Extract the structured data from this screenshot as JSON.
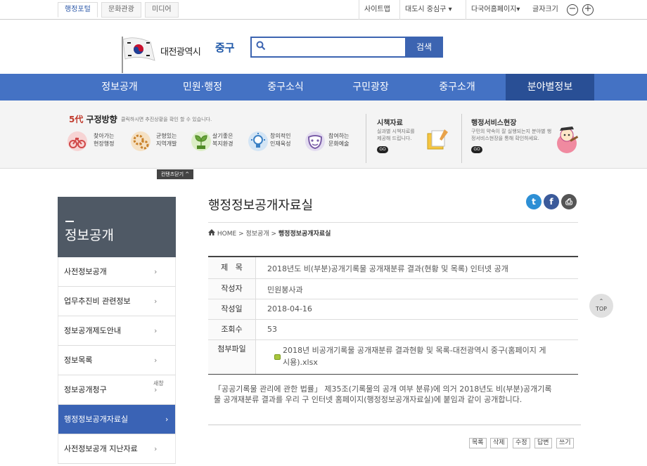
{
  "util": {
    "portal_tabs": [
      "행정포털",
      "문화관광",
      "미디어"
    ],
    "sitemap": "사이트맵",
    "district": "대도시 중심구",
    "multilang": "다국어홈페이지",
    "fontsize": "글자크기",
    "minus": "−",
    "plus": "+"
  },
  "header": {
    "city": "대전광역시",
    "gu": "중구",
    "search_icon_glyph": "🔍",
    "search_btn": "검색"
  },
  "gnb": [
    "정보공개",
    "민원·행정",
    "중구소식",
    "구민광장",
    "중구소개",
    "분야별정보"
  ],
  "banner": {
    "five_num": "5代",
    "five_title": "구정방향",
    "five_desc": "클릭하시면 추진상황을 확인 할 수 있습니다.",
    "items": [
      {
        "l1": "찾아가는",
        "l2": "현장행정"
      },
      {
        "l1": "균형있는",
        "l2": "지역개발"
      },
      {
        "l1": "살기좋은",
        "l2": "복지환경"
      },
      {
        "l1": "창의적인",
        "l2": "인재육성"
      },
      {
        "l1": "참여하는",
        "l2": "문화예술"
      }
    ],
    "policy_title": "시책자료",
    "policy_desc": "실과별 시책자료를 제공해 드립니다.",
    "service_title": "행정서비스현장",
    "service_desc": "구민의 약속이 잘 실행되는지 분야별 행정서비스현장을 통해 확인하세요.",
    "go": "GO",
    "close_tab": "컨텐츠닫기 ^"
  },
  "sidebar": {
    "title": "정보공개",
    "items": [
      "사전정보공개",
      "업무추진비 관련정보",
      "정보공개제도안내",
      "정보목록",
      "정보공개청구",
      "행정정보공개자료실",
      "사전정보공개 지난자료"
    ],
    "new_window": "새창"
  },
  "main": {
    "title": "행정정보공개자료실",
    "social": {
      "twitter": "t",
      "facebook": "f",
      "print": "⎙"
    },
    "breadcrumb": {
      "home": "HOME",
      "sep": ">",
      "level1": "정보공개",
      "current": "행정정보공개자료실"
    },
    "fields": {
      "title_label": "제   목",
      "title_value": "2018년도 비(부분)공개기록물 공개재분류 결과(현황 및 목록) 인터넷 공개",
      "author_label": "작성자",
      "author_value": "민원봉사과",
      "date_label": "작성일",
      "date_value": "2018-04-16",
      "views_label": "조회수",
      "views_value": "53",
      "file_label": "첨부파일",
      "file_line1": "2018년 비공개기록물 공개재분류 결과현황 및 목록-대전광역시 중구(홈페이지 게",
      "file_line2": "시용).xlsx"
    },
    "content_line1": "「공공기록물 관리에 관한 법률」 제35조(기록물의 공개 여부 분류)에 의거 2018년도 비(부분)공개기록",
    "content_line2": "물 공개재분류 결과를 우리 구 인터넷 홈페이지(행정정보공개자료실)에 붙임과 같이 공개합니다.",
    "buttons": [
      "목록",
      "삭제",
      "수정",
      "답변",
      "쓰기"
    ],
    "top_btn": "TOP"
  }
}
